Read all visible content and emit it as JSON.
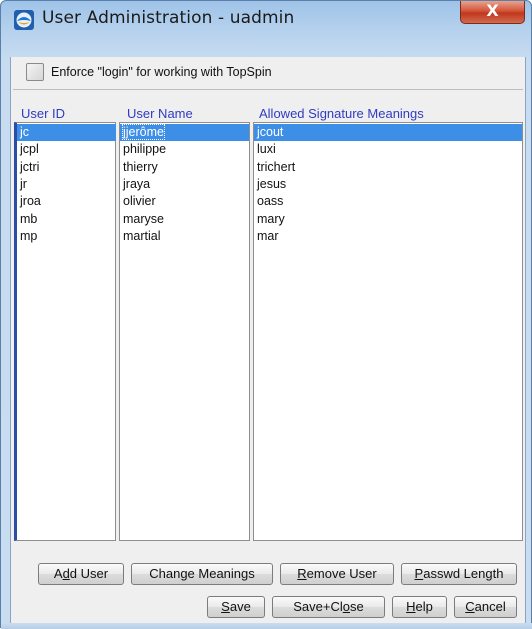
{
  "window": {
    "title": "User Administration - uadmin",
    "close_label": "X",
    "accent_title_gradient": "#9ec3e8",
    "close_color": "#c1371d"
  },
  "enforce": {
    "label": "Enforce \"login\" for working with TopSpin",
    "checked": false
  },
  "table": {
    "headers": [
      "User ID",
      "User Name",
      "Allowed Signature Meanings"
    ],
    "header_color": "#2f3cc2",
    "selection_color": "#3d8ee6",
    "rows": [
      {
        "id": "jc",
        "name": "jjerôme",
        "meanings": "jcout",
        "selected": true
      },
      {
        "id": "jcpl",
        "name": "philippe",
        "meanings": "luxi",
        "selected": false
      },
      {
        "id": "jctri",
        "name": "thierry",
        "meanings": "trichert",
        "selected": false
      },
      {
        "id": "jr",
        "name": "jraya",
        "meanings": "jesus",
        "selected": false
      },
      {
        "id": "jroa",
        "name": "olivier",
        "meanings": "oass",
        "selected": false
      },
      {
        "id": "mb",
        "name": "maryse",
        "meanings": "mary",
        "selected": false
      },
      {
        "id": "mp",
        "name": "martial",
        "meanings": "mar",
        "selected": false
      }
    ]
  },
  "buttons": {
    "row1": [
      {
        "key": "add_user",
        "pre": "A",
        "mn": "d",
        "post": "d User"
      },
      {
        "key": "change_meanings",
        "pre": "Chan",
        "mn": "g",
        "post": "e Meanings"
      },
      {
        "key": "remove_user",
        "pre": "",
        "mn": "R",
        "post": "emove User"
      },
      {
        "key": "passwd_length",
        "pre": "",
        "mn": "P",
        "post": "asswd Length"
      }
    ],
    "row2": [
      {
        "key": "save",
        "pre": "",
        "mn": "S",
        "post": "ave"
      },
      {
        "key": "save_close",
        "pre": "Save+Cl",
        "mn": "o",
        "post": "se"
      },
      {
        "key": "help",
        "pre": "",
        "mn": "H",
        "post": "elp"
      },
      {
        "key": "cancel",
        "pre": "",
        "mn": "C",
        "post": "ancel"
      }
    ]
  }
}
